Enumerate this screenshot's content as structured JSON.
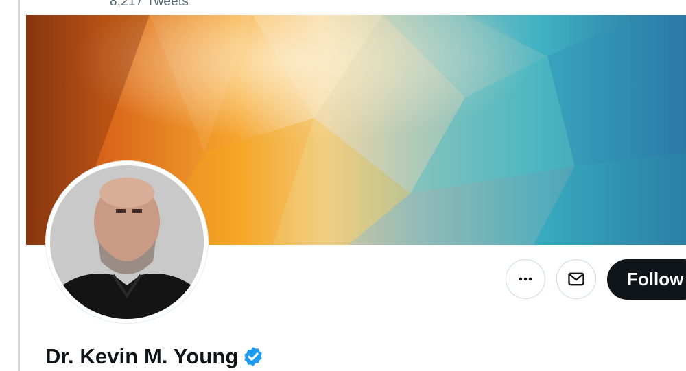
{
  "header": {
    "tweet_count": "8,217 Tweets"
  },
  "profile": {
    "display_name": "Dr. Kevin M. Young",
    "verified": true
  },
  "actions": {
    "more_icon": "more-horizontal-icon",
    "message_icon": "envelope-icon",
    "follow_label": "Follow"
  },
  "colors": {
    "follow_bg": "#0f1419",
    "verified_blue": "#1d9bf0",
    "text_secondary": "#536471"
  }
}
